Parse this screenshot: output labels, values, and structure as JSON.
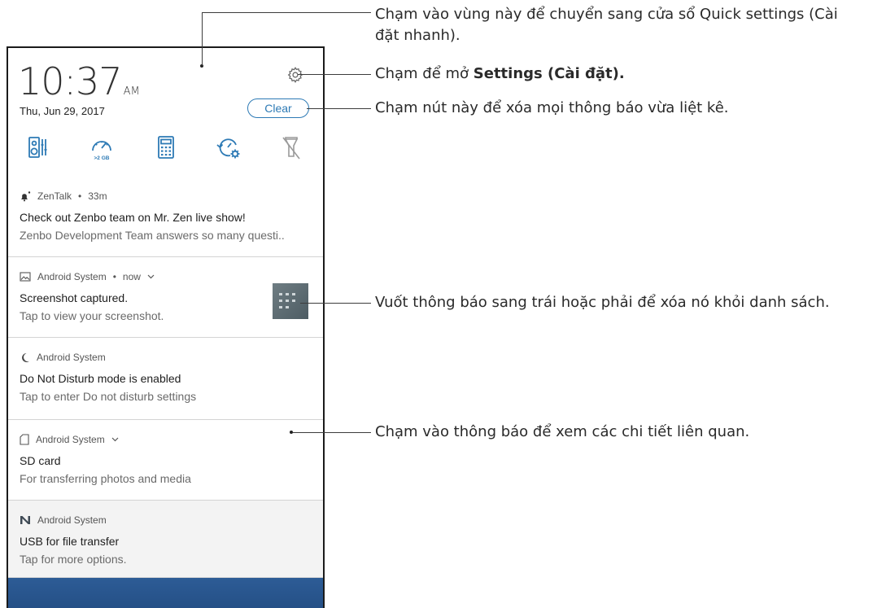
{
  "status": {
    "time": "10:37",
    "ampm": "AM",
    "date": "Thu, Jun 29, 2017"
  },
  "quick_settings": {
    "clear_label": "Clear",
    "tiles": [
      "audio-wizard-icon",
      "boost-memory-icon",
      "calculator-icon",
      "auto-start-manager-icon",
      "flashlight-off-icon"
    ],
    "boost_label": ">2 GB"
  },
  "notifications": [
    {
      "app": "ZenTalk",
      "time": "33m",
      "title": "Check out Zenbo team on Mr. Zen live show!",
      "body": "Zenbo Development Team answers so many questi.."
    },
    {
      "app": "Android System",
      "time": "now",
      "title": "Screenshot captured.",
      "body": "Tap to view your screenshot."
    },
    {
      "app": "Android System",
      "title": "Do Not Disturb mode is enabled",
      "body": "Tap to enter Do not disturb settings"
    },
    {
      "app": "Android System",
      "title": "SD card",
      "body": "For transferring photos and media"
    },
    {
      "app": "Android System",
      "title": "USB for file transfer",
      "body": "Tap for more options."
    }
  ],
  "sep": "•",
  "annotations": {
    "quick_settings_line1": "Chạm vào vùng này để chuyển sang cửa sổ Quick settings (Cài",
    "quick_settings_line2": "đặt nhanh).",
    "settings_prefix": "Chạm để mở ",
    "settings_bold": "Settings (Cài đặt).",
    "clear": "Chạm nút này để xóa mọi thông báo vừa liệt kê.",
    "swipe": "Vuốt thông báo sang trái hoặc phải để xóa nó khỏi danh sách.",
    "tap": "Chạm vào thông báo để xem các chi tiết liên quan."
  },
  "colors": {
    "accent": "#2d7ab5",
    "wallpaper": "#2d5c96"
  }
}
